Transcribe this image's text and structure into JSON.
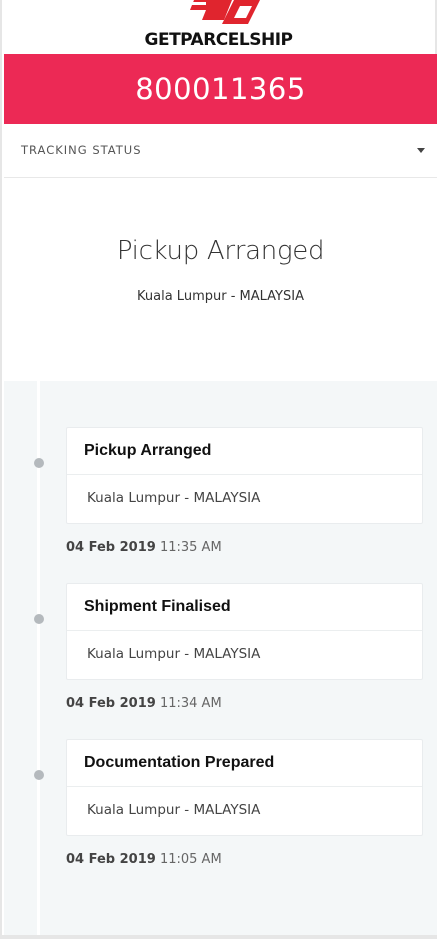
{
  "brand": {
    "name": "GETPARCELSHIP",
    "accent": "#ec2955"
  },
  "tracking_number": "800011365",
  "status_dropdown": {
    "label": "TRACKING STATUS",
    "icon": "caret-down-icon"
  },
  "current_status": {
    "title": "Pickup Arranged",
    "location": "Kuala Lumpur - MALAYSIA"
  },
  "events": [
    {
      "title": "Pickup Arranged",
      "location": "Kuala Lumpur - MALAYSIA",
      "date": "04 Feb 2019",
      "time": "11:35 AM"
    },
    {
      "title": "Shipment Finalised",
      "location": "Kuala Lumpur - MALAYSIA",
      "date": "04 Feb 2019",
      "time": "11:34 AM"
    },
    {
      "title": "Documentation Prepared",
      "location": "Kuala Lumpur - MALAYSIA",
      "date": "04 Feb 2019",
      "time": "11:05 AM"
    }
  ]
}
